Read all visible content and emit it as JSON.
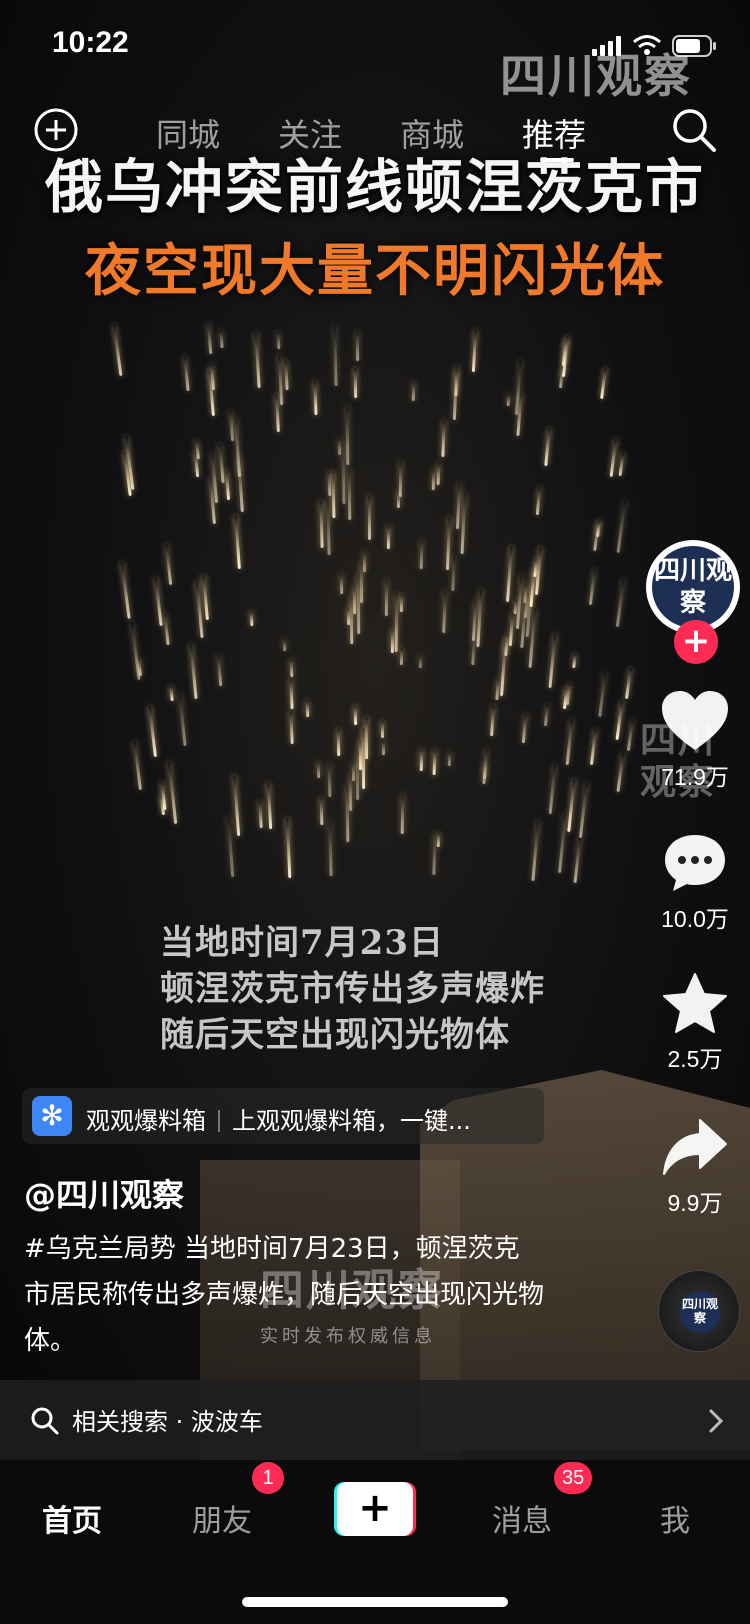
{
  "status_bar": {
    "time": "10:22"
  },
  "watermark": {
    "text": "四川观察"
  },
  "top_nav": {
    "tabs": [
      {
        "label": "同城",
        "active": false
      },
      {
        "label": "关注",
        "active": false
      },
      {
        "label": "商城",
        "active": false
      },
      {
        "label": "推荐",
        "active": true
      }
    ]
  },
  "video": {
    "headline": "俄乌冲突前线顿涅茨克市",
    "subheadline": "夜空现大量不明闪光体",
    "caption_lines": [
      "当地时间7月23日",
      "顿涅茨克市传出多声爆炸",
      "随后天空出现闪光物体"
    ],
    "logo_text": "四川观察",
    "bottom_banner": "实时发布权威信息",
    "accent_color": "#f07a2a"
  },
  "rail": {
    "avatar_text": "四川观察",
    "follow_label": "+",
    "likes": "71.9万",
    "comments": "10.0万",
    "favorites": "2.5万",
    "shares": "9.9万",
    "disc_text": "四川观察"
  },
  "tag_pill": {
    "source": "观观爆料箱",
    "text": "上观观爆料箱，一键..."
  },
  "post": {
    "author": "@四川观察",
    "description": "#乌克兰局势 当地时间7月23日，顿涅茨克市居民称传出多声爆炸，随后天空出现闪光物体。"
  },
  "related_search": {
    "label": "相关搜索 · 波波车"
  },
  "tab_bar": {
    "items": [
      {
        "label": "首页",
        "active": true
      },
      {
        "label": "朋友",
        "badge": "1"
      },
      {
        "label": "消息",
        "badge": "35"
      },
      {
        "label": "我"
      }
    ],
    "create_label": "+"
  },
  "colors": {
    "brand_red": "#fe2c55",
    "brand_cyan": "#25f4ee",
    "tag_blue": "#3e86f5"
  }
}
